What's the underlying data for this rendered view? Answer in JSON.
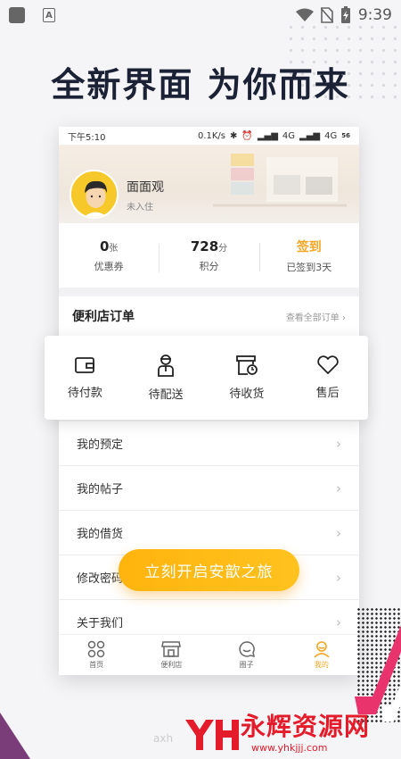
{
  "device": {
    "time": "9:39"
  },
  "headline": "全新界面 为你而来",
  "phone": {
    "status": {
      "time": "下午5:10",
      "speed": "0.1K/s",
      "net1": "4G",
      "net2": "4G",
      "battery": "56"
    },
    "profile": {
      "nickname": "面面观",
      "status": "未入住"
    },
    "stats": [
      {
        "value": "0",
        "unit": "张",
        "label": "优惠券"
      },
      {
        "value": "728",
        "unit": "分",
        "label": "积分"
      },
      {
        "value": "签到",
        "unit": "",
        "label": "已签到3天"
      }
    ],
    "orders": {
      "title": "便利店订单",
      "view_all": "查看全部订单 ›"
    },
    "menu": [
      {
        "label": "我的预定"
      },
      {
        "label": "我的帖子"
      },
      {
        "label": "我的借货"
      },
      {
        "label": "修改密码"
      },
      {
        "label": "关于我们"
      }
    ],
    "tabs": [
      {
        "label": "首页",
        "icon": "home-grid-icon"
      },
      {
        "label": "便利店",
        "icon": "store-icon"
      },
      {
        "label": "圈子",
        "icon": "chat-bubble-icon"
      },
      {
        "label": "我的",
        "icon": "user-icon"
      }
    ]
  },
  "order_card": [
    {
      "label": "待付款",
      "icon": "wallet-icon"
    },
    {
      "label": "待配送",
      "icon": "courier-icon"
    },
    {
      "label": "待收货",
      "icon": "box-clock-icon"
    },
    {
      "label": "售后",
      "icon": "heart-icon"
    }
  ],
  "cta": "立刻开启安歆之旅",
  "watermark": {
    "text": "永辉资源网",
    "url": "www.yhkjjj.com",
    "faded": "axh"
  },
  "colors": {
    "accent": "#f5a623",
    "cta": "#ffb40d",
    "headline": "#1c2235",
    "watermark": "#e31b2a"
  }
}
